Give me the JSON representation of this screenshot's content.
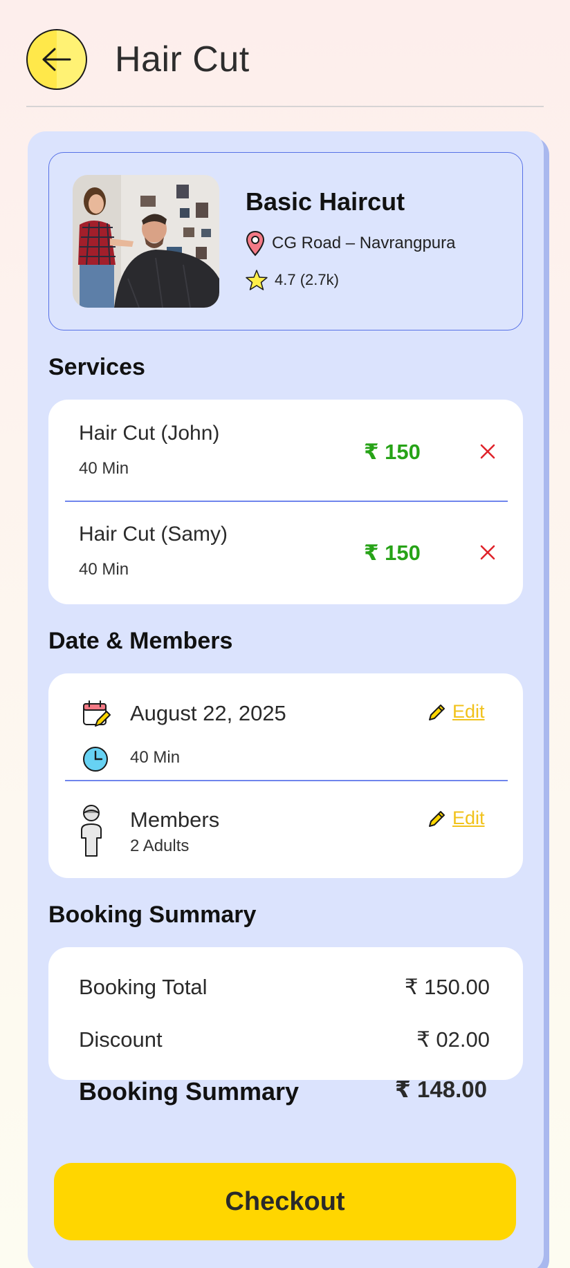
{
  "header": {
    "title": "Hair Cut"
  },
  "shop": {
    "name": "Basic Haircut",
    "location": "CG Road – Navrangpura",
    "rating": "4.7 (2.7k)"
  },
  "services": {
    "title": "Services",
    "items": [
      {
        "name": "Hair Cut (John)",
        "duration": "40 Min",
        "price": "₹ 150"
      },
      {
        "name": "Hair Cut (Samy)",
        "duration": "40 Min",
        "price": "₹ 150"
      }
    ],
    "price_color": "#27a317",
    "remove_color": "#e0232b"
  },
  "date_members": {
    "title": "Date & Members",
    "date": "August 22, 2025",
    "duration": "40 Min",
    "members_label": "Members",
    "members_value": "2 Adults",
    "edit_label": "Edit"
  },
  "summary": {
    "title": "Booking Summary",
    "rows": [
      {
        "label": "Booking Total",
        "value": "₹ 150.00"
      },
      {
        "label": "Discount",
        "value": "₹ 02.00"
      }
    ],
    "total_label": "Booking Summary",
    "total_value": "₹ 148.00"
  },
  "checkout": {
    "label": "Checkout",
    "color": "#ffd600"
  },
  "icons": [
    "back-arrow-icon",
    "location-pin-icon",
    "star-icon",
    "close-icon",
    "calendar-icon",
    "clock-icon",
    "person-icon",
    "pencil-icon"
  ]
}
